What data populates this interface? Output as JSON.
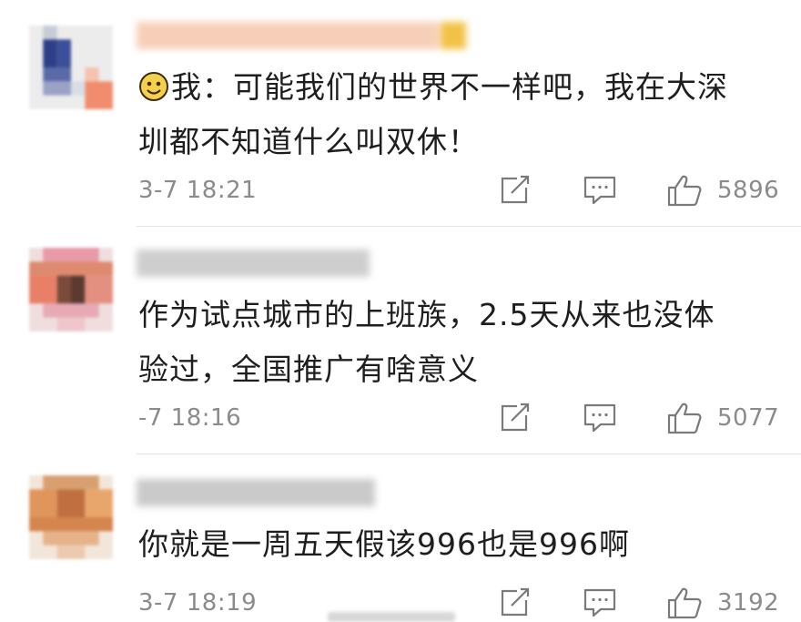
{
  "comments": [
    {
      "body_lines": [
        "我：可能我们的世界不一样吧，我在大深",
        "圳都不知道什么叫双休！"
      ],
      "time": "3-7 18:21",
      "likes": "5896",
      "emoji_icon": "smiley-face-icon",
      "name_color": "#f5b48c",
      "name_badge_color": "#f3c049"
    },
    {
      "body_lines": [
        "作为试点城市的上班族，2.5天从来也没体",
        "验过，全国推广有啥意义"
      ],
      "time": "-7 18:16",
      "likes": "5077",
      "name_color": "#c9c9c9"
    },
    {
      "body_lines": [
        "你就是一周五天假该996也是996啊"
      ],
      "time": "3-7 18:19",
      "likes": "3192",
      "name_color": "#c4c4c4"
    }
  ],
  "icons": {
    "share": "share-icon",
    "comment": "comment-icon",
    "like": "thumbs-up-icon"
  },
  "colors": {
    "meta_text": "#8b8b8b",
    "body_text": "#1e1e1e",
    "icon_stroke": "#7a7a7a"
  }
}
